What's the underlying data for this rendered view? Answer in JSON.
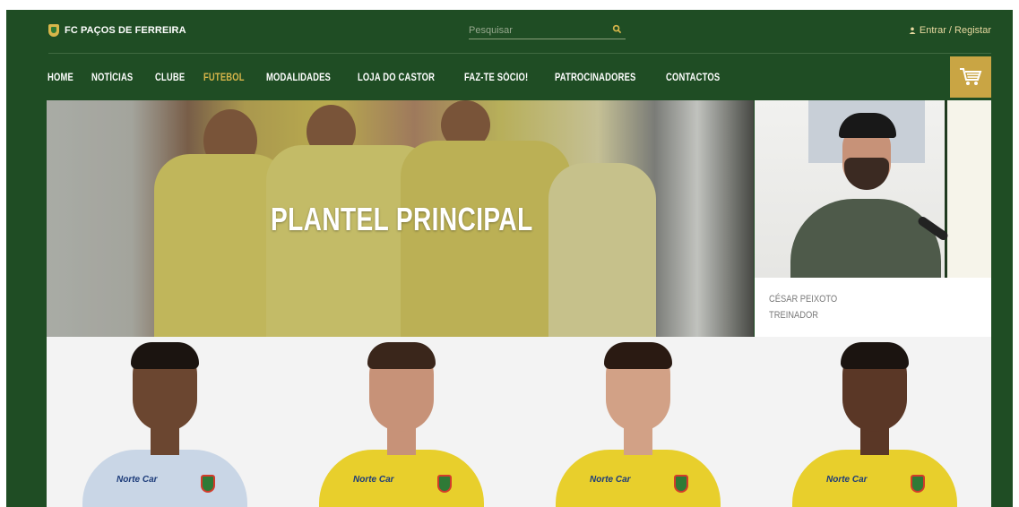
{
  "header": {
    "brand": "FC PAÇOS DE FERREIRA",
    "search_placeholder": "Pesquisar",
    "login": "Entrar / Registar"
  },
  "nav": {
    "items": [
      {
        "label": "HOME"
      },
      {
        "label": "NOTÍCIAS"
      },
      {
        "label": "CLUBE"
      },
      {
        "label": "FUTEBOL"
      },
      {
        "label": "MODALIDADES"
      },
      {
        "label": "LOJA DO CASTOR"
      },
      {
        "label": "FAZ-TE SÓCIO!"
      },
      {
        "label": "PATROCINADORES"
      },
      {
        "label": "CONTACTOS"
      }
    ],
    "active": "FUTEBOL"
  },
  "hero": {
    "title": "PLANTEL PRINCIPAL"
  },
  "coach": {
    "name": "CÉSAR PEIXOTO",
    "role": "TREINADOR"
  },
  "players": [
    {
      "kit": "goalkeeper",
      "sponsor": "Norte Car"
    },
    {
      "kit": "home",
      "sponsor": "Norte Car"
    },
    {
      "kit": "home",
      "sponsor": "Norte Car"
    },
    {
      "kit": "home",
      "sponsor": "Norte Car"
    }
  ],
  "colors": {
    "header_bg": "#1f4d24",
    "accent_gold": "#d8b64a",
    "cart_bg": "#c9a544",
    "kit_yellow": "#e8cf2c",
    "kit_goalkeeper": "#c9d6e6"
  },
  "icons": {
    "search": "search-icon",
    "user": "user-icon",
    "cart": "shopping-cart-icon",
    "crest": "club-crest-icon"
  }
}
